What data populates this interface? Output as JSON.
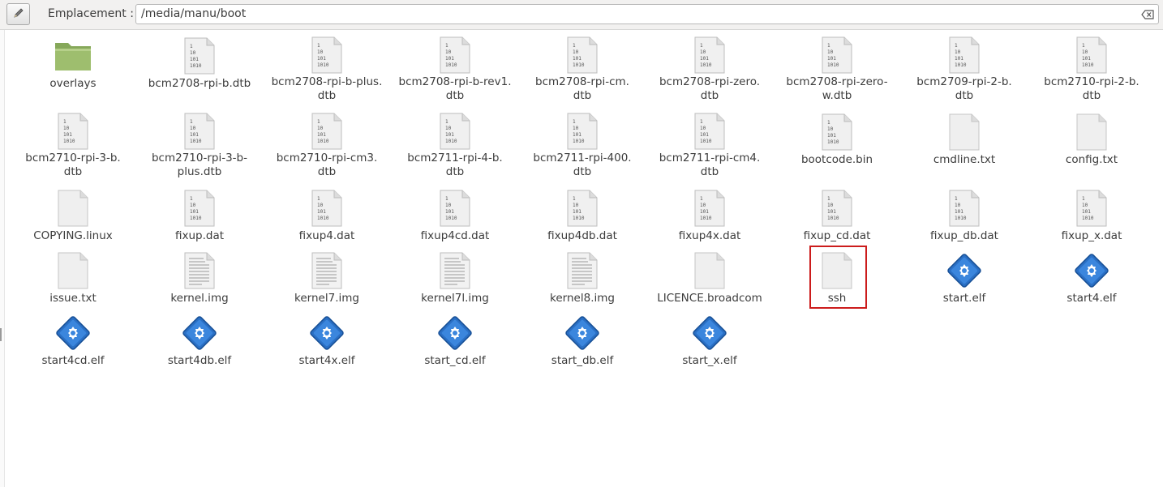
{
  "toolbar": {
    "edit_icon": "pencil-icon",
    "location_label": "Emplacement :",
    "location_value": "/media/manu/boot",
    "clear_icon": "clear-text-icon"
  },
  "files": [
    {
      "name": "overlays",
      "icon": "folder"
    },
    {
      "name": "bcm2708-rpi-b.dtb",
      "icon": "binary"
    },
    {
      "name": "bcm2708-rpi-b-plus.\ndtb",
      "icon": "binary"
    },
    {
      "name": "bcm2708-rpi-b-rev1.\ndtb",
      "icon": "binary"
    },
    {
      "name": "bcm2708-rpi-cm.\ndtb",
      "icon": "binary"
    },
    {
      "name": "bcm2708-rpi-zero.\ndtb",
      "icon": "binary"
    },
    {
      "name": "bcm2708-rpi-zero-\nw.dtb",
      "icon": "binary"
    },
    {
      "name": "bcm2709-rpi-2-b.\ndtb",
      "icon": "binary"
    },
    {
      "name": "bcm2710-rpi-2-b.\ndtb",
      "icon": "binary"
    },
    {
      "name": "bcm2710-rpi-3-b.\ndtb",
      "icon": "binary"
    },
    {
      "name": "bcm2710-rpi-3-b-\nplus.dtb",
      "icon": "binary"
    },
    {
      "name": "bcm2710-rpi-cm3.\ndtb",
      "icon": "binary"
    },
    {
      "name": "bcm2711-rpi-4-b.\ndtb",
      "icon": "binary"
    },
    {
      "name": "bcm2711-rpi-400.\ndtb",
      "icon": "binary"
    },
    {
      "name": "bcm2711-rpi-cm4.\ndtb",
      "icon": "binary"
    },
    {
      "name": "bootcode.bin",
      "icon": "binary"
    },
    {
      "name": "cmdline.txt",
      "icon": "blank"
    },
    {
      "name": "config.txt",
      "icon": "blank"
    },
    {
      "name": "COPYING.linux",
      "icon": "blank"
    },
    {
      "name": "fixup.dat",
      "icon": "binary"
    },
    {
      "name": "fixup4.dat",
      "icon": "binary"
    },
    {
      "name": "fixup4cd.dat",
      "icon": "binary"
    },
    {
      "name": "fixup4db.dat",
      "icon": "binary"
    },
    {
      "name": "fixup4x.dat",
      "icon": "binary"
    },
    {
      "name": "fixup_cd.dat",
      "icon": "binary"
    },
    {
      "name": "fixup_db.dat",
      "icon": "binary"
    },
    {
      "name": "fixup_x.dat",
      "icon": "binary"
    },
    {
      "name": "issue.txt",
      "icon": "blank"
    },
    {
      "name": "kernel.img",
      "icon": "text"
    },
    {
      "name": "kernel7.img",
      "icon": "text"
    },
    {
      "name": "kernel7l.img",
      "icon": "text"
    },
    {
      "name": "kernel8.img",
      "icon": "text"
    },
    {
      "name": "LICENCE.broadcom",
      "icon": "blank"
    },
    {
      "name": "ssh",
      "icon": "blank",
      "highlighted": true
    },
    {
      "name": "start.elf",
      "icon": "executable"
    },
    {
      "name": "start4.elf",
      "icon": "executable"
    },
    {
      "name": "start4cd.elf",
      "icon": "executable"
    },
    {
      "name": "start4db.elf",
      "icon": "executable"
    },
    {
      "name": "start4x.elf",
      "icon": "executable"
    },
    {
      "name": "start_cd.elf",
      "icon": "executable"
    },
    {
      "name": "start_db.elf",
      "icon": "executable"
    },
    {
      "name": "start_x.elf",
      "icon": "executable"
    }
  ]
}
